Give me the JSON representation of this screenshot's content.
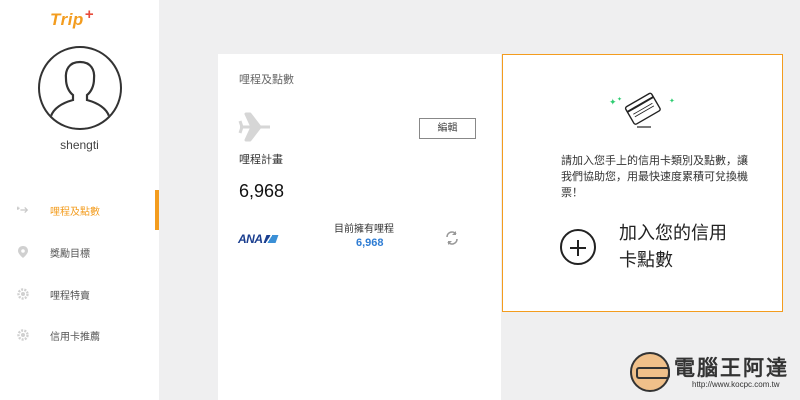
{
  "brand": {
    "name": "Trip",
    "mark": "+"
  },
  "user": {
    "name": "shengti"
  },
  "nav": [
    {
      "label": "哩程及點數",
      "icon": "plane-add-icon",
      "active": true
    },
    {
      "label": "獎勵目標",
      "icon": "location-pin-icon",
      "active": false
    },
    {
      "label": "哩程特賣",
      "icon": "gear-icon",
      "active": false
    },
    {
      "label": "信用卡推薦",
      "icon": "gear-icon",
      "active": false
    }
  ],
  "miles_card": {
    "title": "哩程及點數",
    "edit_label": "編輯",
    "plan_label": "哩程計畫",
    "plan_value": "6,968",
    "airline_logo": "ANA",
    "current_miles_label": "目前擁有哩程",
    "current_miles_value": "6,968"
  },
  "credit_card_card": {
    "promo_text": "請加入您手上的信用卡類別及點數，讓我們協助您，用最快速度累積可兌換機票！",
    "add_label": "加入您的信用卡點數"
  },
  "watermark": {
    "title": "電腦王阿達",
    "url": "http://www.kocpc.com.tw"
  },
  "colors": {
    "accent": "#f39c1e",
    "link_blue": "#2e7cd3",
    "background": "#efeff0",
    "airline_blue": "#1a3e8f"
  }
}
